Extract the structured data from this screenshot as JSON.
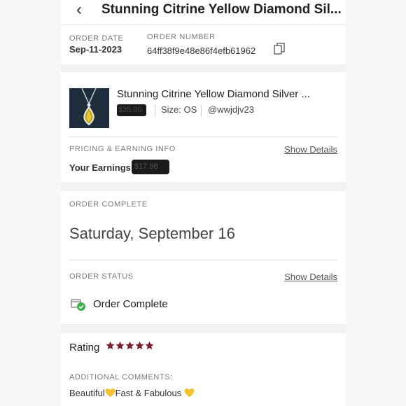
{
  "header": {
    "back_icon": "chevron-left-icon",
    "title": "Stunning Citrine Yellow Diamond Sil..."
  },
  "order": {
    "date_label": "ORDER DATE",
    "date_value": "Sep-11-2023",
    "number_label": "ORDER NUMBER",
    "number_value": "64ff38f9e48e86f4efb61962",
    "copy_icon": "copy-icon"
  },
  "item": {
    "title": "Stunning Citrine Yellow Diamond Silver ...",
    "price": "$35.00",
    "size": "Size: OS",
    "seller": "@wwjdjv23"
  },
  "pricing": {
    "label": "PRICING & EARNING INFO",
    "show_details": "Show Details",
    "earnings_label": "Your Earnings:",
    "earnings_value": "$17.98"
  },
  "completion": {
    "label": "ORDER COMPLETE",
    "date": "Saturday, September 16"
  },
  "status": {
    "label": "ORDER STATUS",
    "show_details": "Show Details",
    "icon": "order-complete-icon",
    "text": "Order Complete"
  },
  "rating": {
    "label": "Rating",
    "stars": 5,
    "max_stars": 5,
    "star_color": "#7b1c2a",
    "comments_label": "ADDITIONAL COMMENTS:",
    "comment_part1": "Beautiful",
    "comment_part2": "Fast & Fabulous",
    "heart_color": "#f4c430"
  }
}
